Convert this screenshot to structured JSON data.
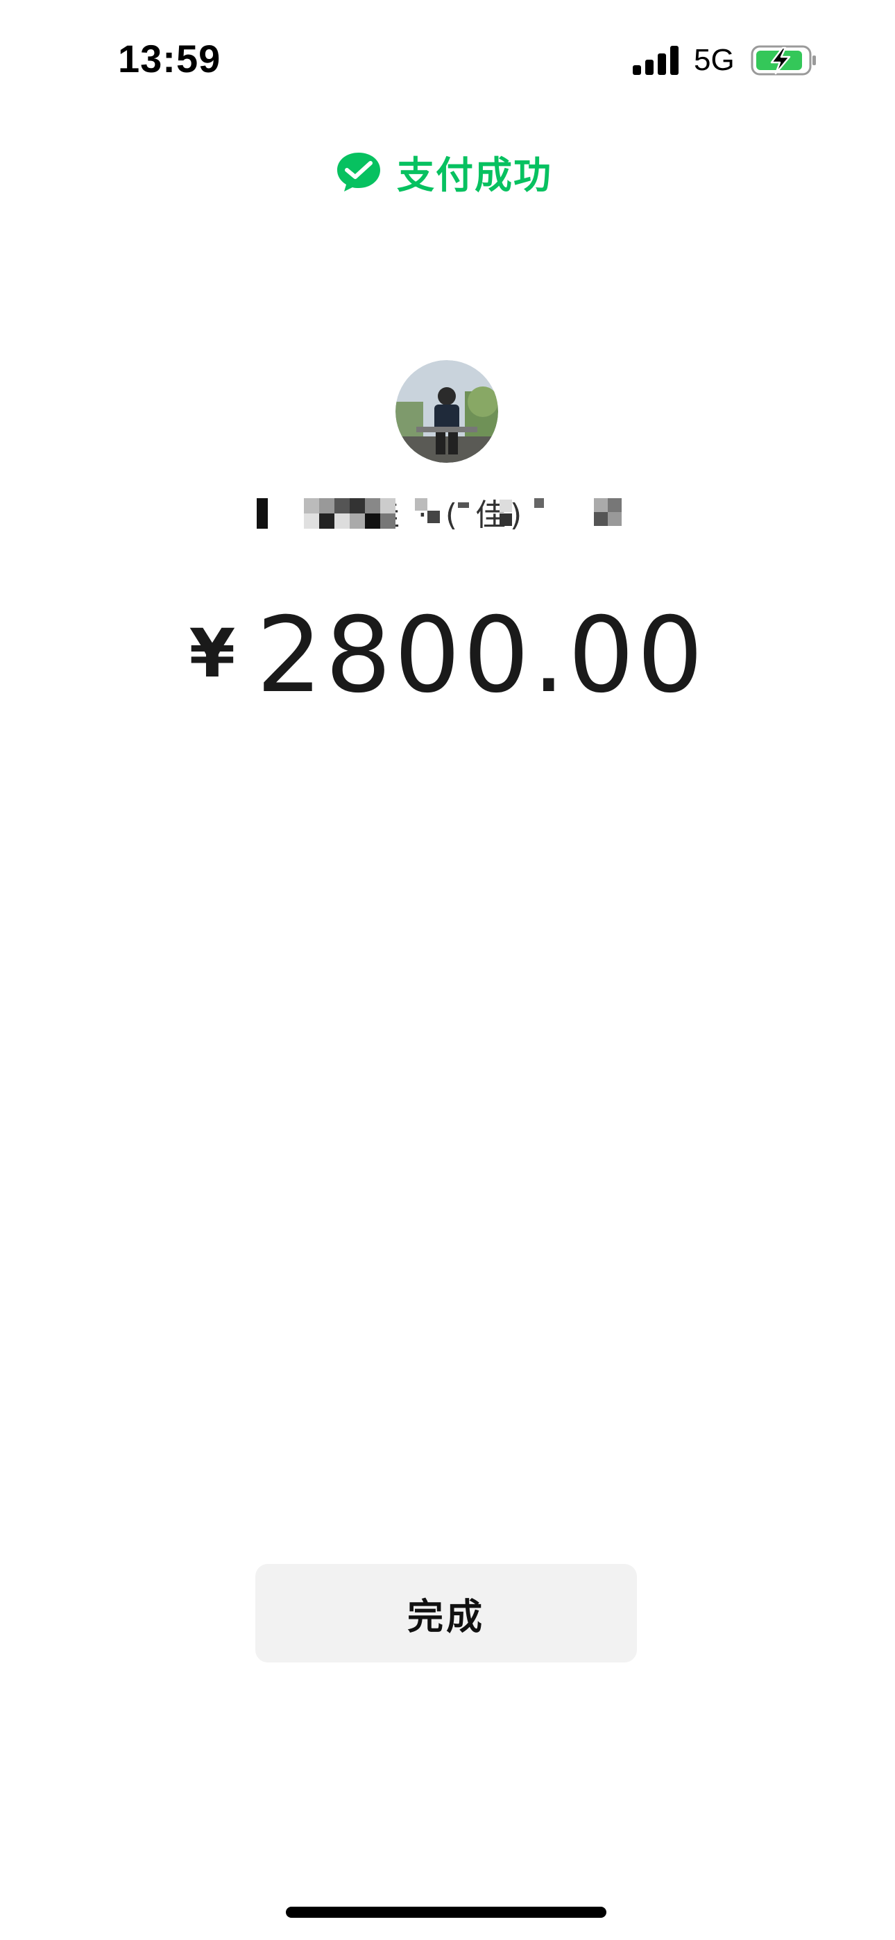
{
  "status_bar": {
    "time": "13:59",
    "carrier": "5G",
    "signal_icon": "cellular-signal-icon",
    "battery_icon": "battery-charging-icon",
    "battery_color": "#34c759"
  },
  "header": {
    "icon": "wechat-pay-icon",
    "title": "支付成功",
    "accent_color": "#07c160"
  },
  "payee": {
    "avatar_icon": "payee-avatar",
    "name_visible": "佳 ·                        ( 佳)"
  },
  "payment": {
    "currency_symbol": "¥",
    "amount": "2800.00"
  },
  "actions": {
    "done_label": "完成"
  }
}
